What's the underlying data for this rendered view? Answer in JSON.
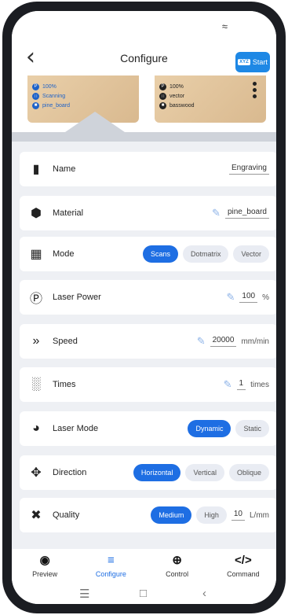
{
  "header": {
    "title": "Configure",
    "start_label": "Start",
    "start_badge": "XYZ"
  },
  "preview": {
    "left_card": {
      "power": "100%",
      "mode": "Scanning",
      "material": "pine_board"
    },
    "right_card": {
      "power": "100%",
      "mode": "vector",
      "material": "basswood"
    }
  },
  "rows": {
    "name": {
      "label": "Name",
      "value": "Engraving"
    },
    "material": {
      "label": "Material",
      "value": "pine_board"
    },
    "mode": {
      "label": "Mode",
      "options": [
        "Scans",
        "Dotmatrix",
        "Vector"
      ],
      "selected": "Scans"
    },
    "laser_power": {
      "label": "Laser Power",
      "value": "100",
      "unit": "%"
    },
    "speed": {
      "label": "Speed",
      "value": "20000",
      "unit": "mm/min"
    },
    "times": {
      "label": "Times",
      "value": "1",
      "unit": "times"
    },
    "laser_mode": {
      "label": "Laser Mode",
      "options": [
        "Dynamic",
        "Static"
      ],
      "selected": "Dynamic"
    },
    "direction": {
      "label": "Direction",
      "options": [
        "Horizontal",
        "Vertical",
        "Oblique"
      ],
      "selected": "Horizontal"
    },
    "quality": {
      "label": "Quality",
      "options": [
        "Medium",
        "High"
      ],
      "selected": "Medium",
      "value": "10",
      "unit": "L/mm"
    }
  },
  "nav": [
    {
      "label": "Preview",
      "icon": "eye-icon"
    },
    {
      "label": "Configure",
      "icon": "sliders-icon",
      "active": true
    },
    {
      "label": "Control",
      "icon": "crosshair-icon"
    },
    {
      "label": "Command",
      "icon": "code-icon"
    }
  ],
  "colors": {
    "accent": "#1e6ee3",
    "background": "#eef0f4"
  }
}
